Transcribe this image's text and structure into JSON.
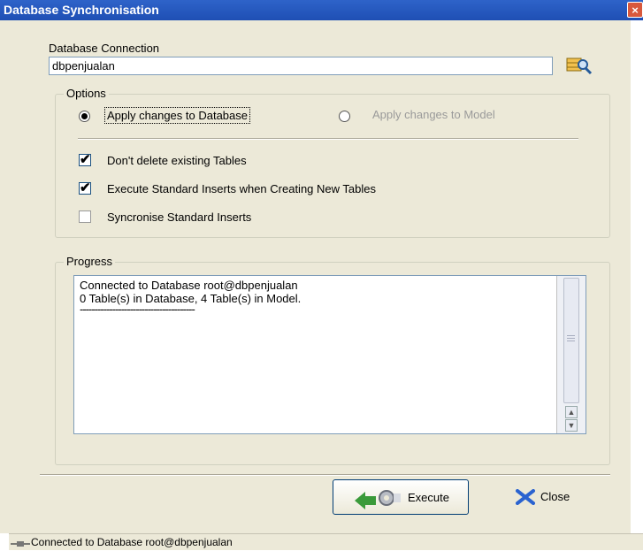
{
  "window": {
    "title": "Database Synchronisation",
    "close_glyph": "×"
  },
  "connection": {
    "label": "Database Connection",
    "value": "dbpenjualan",
    "browse_icon": "database-search-icon"
  },
  "options": {
    "legend": "Options",
    "radio_database": {
      "label": "Apply changes to Database",
      "selected": true
    },
    "radio_model": {
      "label": "Apply changes to Model",
      "selected": false
    },
    "checks": [
      {
        "label": "Don't delete existing Tables",
        "checked": true,
        "mark": "✔"
      },
      {
        "label": "Execute Standard Inserts when Creating New Tables",
        "checked": true,
        "mark": "✔"
      },
      {
        "label": "Syncronise Standard Inserts",
        "checked": false,
        "mark": ""
      }
    ]
  },
  "progress": {
    "legend": "Progress",
    "lines": [
      "Connected to Database root@dbpenjualan",
      "0 Table(s) in Database, 4 Table(s) in Model.",
      "---------------------------------------"
    ]
  },
  "buttons": {
    "execute": "Execute",
    "close": "Close"
  },
  "statusbar": {
    "text": "Connected to Database root@dbpenjualan"
  }
}
